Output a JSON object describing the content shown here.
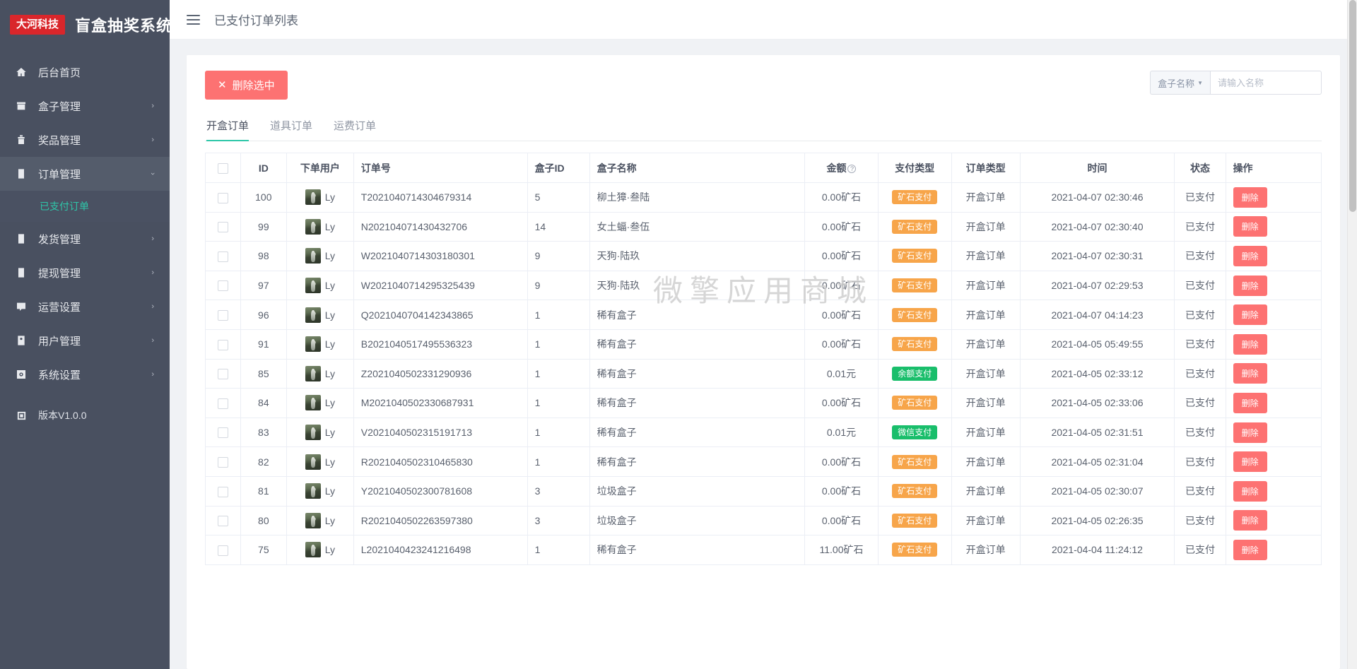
{
  "brand": {
    "logo": "大河科技",
    "title": "盲盒抽奖系统"
  },
  "topbar": {
    "menu_icon": "hamburger-icon",
    "title": "已支付订单列表"
  },
  "sidebar": {
    "items": [
      {
        "icon": "home-icon",
        "label": "后台首页",
        "arrow": ""
      },
      {
        "icon": "box-icon",
        "label": "盒子管理",
        "arrow": "›"
      },
      {
        "icon": "gift-icon",
        "label": "奖品管理",
        "arrow": "›"
      },
      {
        "icon": "order-icon",
        "label": "订单管理",
        "arrow": "⌄"
      },
      {
        "icon": "ship-icon",
        "label": "发货管理",
        "arrow": "›"
      },
      {
        "icon": "cash-icon",
        "label": "提现管理",
        "arrow": "›"
      },
      {
        "icon": "ops-icon",
        "label": "运营设置",
        "arrow": "›"
      },
      {
        "icon": "user-icon",
        "label": "用户管理",
        "arrow": "›"
      },
      {
        "icon": "gear-icon",
        "label": "系统设置",
        "arrow": "›"
      }
    ],
    "submenu": [
      {
        "label": "已支付订单"
      }
    ],
    "version": "版本V1.0.0"
  },
  "toolbar": {
    "delete_selected_label": "删除选中",
    "delete_selected_icon": "close-icon"
  },
  "search": {
    "select_label": "盒子名称",
    "placeholder": "请输入名称",
    "value": ""
  },
  "tabs": [
    {
      "label": "开盒订单",
      "active": true
    },
    {
      "label": "道具订单",
      "active": false
    },
    {
      "label": "运费订单",
      "active": false
    }
  ],
  "watermark": "微擎应用商城",
  "table": {
    "columns": [
      "ID",
      "下单用户",
      "订单号",
      "盒子ID",
      "盒子名称",
      "金额",
      "支付类型",
      "订单类型",
      "时间",
      "状态",
      "操作"
    ],
    "amount_hint_icon": "question-mark-icon",
    "action_label": "删除",
    "rows": [
      {
        "id": "100",
        "user": "Ly",
        "order_no": "T202104071430467931 4",
        "box_id": "5",
        "box_name": "柳土獐·叁陆",
        "amount": "0.00矿石",
        "pay_type": "矿石支付",
        "pay_type_class": "ore",
        "order_type": "开盒订单",
        "time": "2021-04-07 02:30:46",
        "status": "已支付"
      },
      {
        "id": "99",
        "user": "Ly",
        "order_no": "N202104071430432706",
        "box_id": "14",
        "box_name": "女土蝠·叁伍",
        "amount": "0.00矿石",
        "pay_type": "矿石支付",
        "pay_type_class": "ore",
        "order_type": "开盒订单",
        "time": "2021-04-07 02:30:40",
        "status": "已支付"
      },
      {
        "id": "98",
        "user": "Ly",
        "order_no": "W202104071430318 0301",
        "box_id": "9",
        "box_name": "天狗·陆玖",
        "amount": "0.00矿石",
        "pay_type": "矿石支付",
        "pay_type_class": "ore",
        "order_type": "开盒订单",
        "time": "2021-04-07 02:30:31",
        "status": "已支付"
      },
      {
        "id": "97",
        "user": "Ly",
        "order_no": "W202104071429532 5439",
        "box_id": "9",
        "box_name": "天狗·陆玖",
        "amount": "0.00矿石",
        "pay_type": "矿石支付",
        "pay_type_class": "ore",
        "order_type": "开盒订单",
        "time": "2021-04-07 02:29:53",
        "status": "已支付"
      },
      {
        "id": "96",
        "user": "Ly",
        "order_no": "Q202104070414234 3865",
        "box_id": "1",
        "box_name": "稀有盒子",
        "amount": "0.00矿石",
        "pay_type": "矿石支付",
        "pay_type_class": "ore",
        "order_type": "开盒订单",
        "time": "2021-04-07 04:14:23",
        "status": "已支付"
      },
      {
        "id": "91",
        "user": "Ly",
        "order_no": "B202104051749553 6323",
        "box_id": "1",
        "box_name": "稀有盒子",
        "amount": "0.00矿石",
        "pay_type": "矿石支付",
        "pay_type_class": "ore",
        "order_type": "开盒订单",
        "time": "2021-04-05 05:49:55",
        "status": "已支付"
      },
      {
        "id": "85",
        "user": "Ly",
        "order_no": "Z202104050233129 0936",
        "box_id": "1",
        "box_name": "稀有盒子",
        "amount": "0.01元",
        "pay_type": "余额支付",
        "pay_type_class": "balance",
        "order_type": "开盒订单",
        "time": "2021-04-05 02:33:12",
        "status": "已支付"
      },
      {
        "id": "84",
        "user": "Ly",
        "order_no": "M202104050233068 7931",
        "box_id": "1",
        "box_name": "稀有盒子",
        "amount": "0.00矿石",
        "pay_type": "矿石支付",
        "pay_type_class": "ore",
        "order_type": "开盒订单",
        "time": "2021-04-05 02:33:06",
        "status": "已支付"
      },
      {
        "id": "83",
        "user": "Ly",
        "order_no": "V202104050231519 1713",
        "box_id": "1",
        "box_name": "稀有盒子",
        "amount": "0.01元",
        "pay_type": "微信支付",
        "pay_type_class": "wechat",
        "order_type": "开盒订单",
        "time": "2021-04-05 02:31:51",
        "status": "已支付"
      },
      {
        "id": "82",
        "user": "Ly",
        "order_no": "R202104050231046 5830",
        "box_id": "1",
        "box_name": "稀有盒子",
        "amount": "0.00矿石",
        "pay_type": "矿石支付",
        "pay_type_class": "ore",
        "order_type": "开盒订单",
        "time": "2021-04-05 02:31:04",
        "status": "已支付"
      },
      {
        "id": "81",
        "user": "Ly",
        "order_no": "Y202104050230078 1608",
        "box_id": "3",
        "box_name": "垃圾盒子",
        "amount": "0.00矿石",
        "pay_type": "矿石支付",
        "pay_type_class": "ore",
        "order_type": "开盒订单",
        "time": "2021-04-05 02:30:07",
        "status": "已支付"
      },
      {
        "id": "80",
        "user": "Ly",
        "order_no": "R202104050226359 7380",
        "box_id": "3",
        "box_name": "垃圾盒子",
        "amount": "0.00矿石",
        "pay_type": "矿石支付",
        "pay_type_class": "ore",
        "order_type": "开盒订单",
        "time": "2021-04-05 02:26:35",
        "status": "已支付"
      },
      {
        "id": "75",
        "user": "Ly",
        "order_no": "L202104042324121 6498",
        "box_id": "1",
        "box_name": "稀有盒子",
        "amount": "11.00矿石",
        "pay_type": "矿石支付",
        "pay_type_class": "ore",
        "order_type": "开盒订单",
        "time": "2021-04-04 11:24:12",
        "status": "已支付"
      }
    ]
  }
}
